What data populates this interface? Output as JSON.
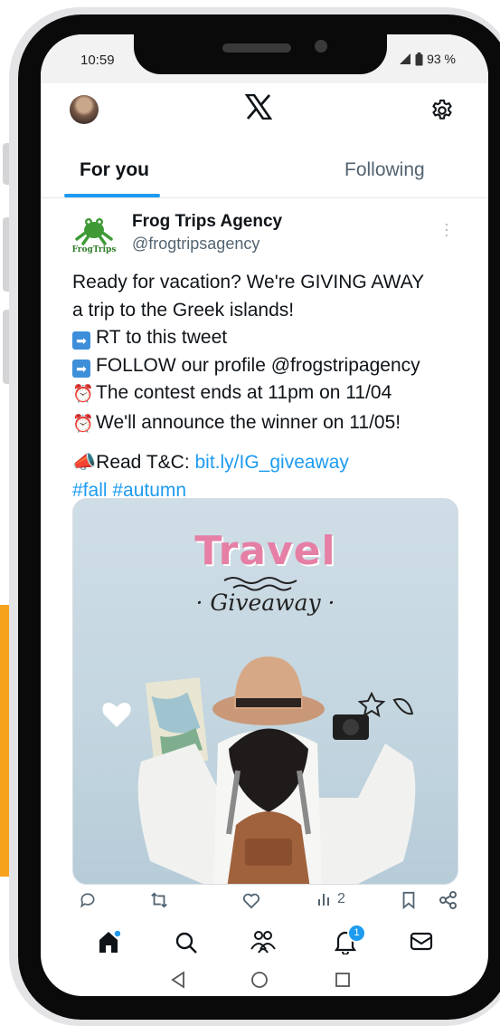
{
  "status_bar": {
    "time": "10:59",
    "battery": "93 %"
  },
  "header": {
    "avatar_icon": "user-avatar",
    "logo_icon": "x-logo-icon",
    "settings_icon": "gear-icon"
  },
  "tabs": [
    {
      "label": "For you",
      "active": true
    },
    {
      "label": "Following",
      "active": false
    }
  ],
  "tweet": {
    "author_name": "Frog Trips Agency",
    "author_handle": "@frogtripsagency",
    "logo_text": "FrogTrips",
    "text_lines": [
      "Ready for vacation? We're GIVING AWAY",
      "a trip to the Greek islands!"
    ],
    "bullets": [
      {
        "icon": "arrow-right-emoji",
        "text": "RT to this tweet"
      },
      {
        "icon": "arrow-right-emoji",
        "text": "FOLLOW our profile @frogstripagency"
      },
      {
        "icon": "alarm-clock-emoji",
        "text": "The contest ends at 11pm on 11/04"
      },
      {
        "icon": "alarm-clock-emoji",
        "text": "We'll announce the winner on 11/05!"
      }
    ],
    "tc_prefix": "Read T&C: ",
    "tc_link": "bit.ly/IG_giveaway",
    "hashtags": "#fall #autumn",
    "media": {
      "title": "Travel",
      "subtitle": "Giveaway"
    },
    "views": "2"
  },
  "bottom_nav": {
    "items": [
      "home-icon",
      "search-icon",
      "communities-icon",
      "notifications-icon",
      "messages-icon"
    ],
    "notification_count": "1"
  },
  "colors": {
    "accent": "#1d9bf0",
    "text": "#0f1419",
    "muted": "#536471",
    "highlight": "#f7a21b"
  }
}
